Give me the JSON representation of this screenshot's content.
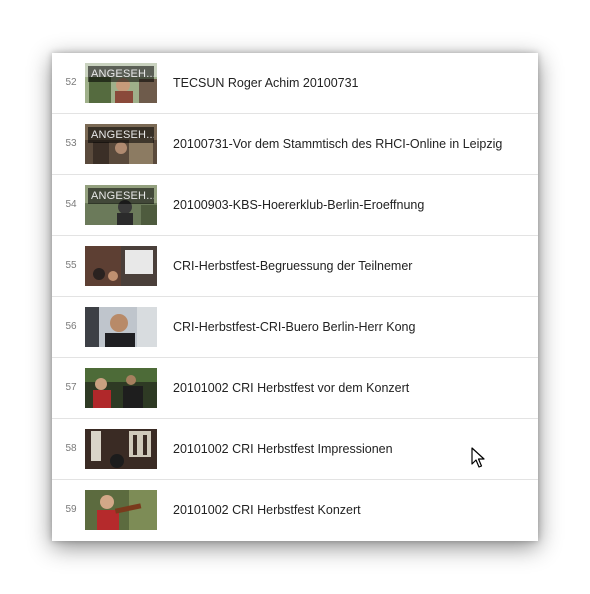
{
  "playlist": {
    "items": [
      {
        "index": "52",
        "title": "TECSUN Roger Achim 20100731",
        "badge": "ANGESEH..."
      },
      {
        "index": "53",
        "title": "20100731-Vor dem Stammtisch des RHCI-Online in Leipzig",
        "badge": "ANGESEH..."
      },
      {
        "index": "54",
        "title": "20100903-KBS-Hoererklub-Berlin-Eroeffnung",
        "badge": "ANGESEH..."
      },
      {
        "index": "55",
        "title": "CRI-Herbstfest-Begruessung der Teilnemer",
        "badge": ""
      },
      {
        "index": "56",
        "title": "CRI-Herbstfest-CRI-Buero Berlin-Herr Kong",
        "badge": ""
      },
      {
        "index": "57",
        "title": "20101002 CRI Herbstfest vor dem Konzert",
        "badge": ""
      },
      {
        "index": "58",
        "title": "20101002 CRI Herbstfest Impressionen",
        "badge": ""
      },
      {
        "index": "59",
        "title": "20101002 CRI Herbstfest Konzert",
        "badge": ""
      }
    ]
  }
}
